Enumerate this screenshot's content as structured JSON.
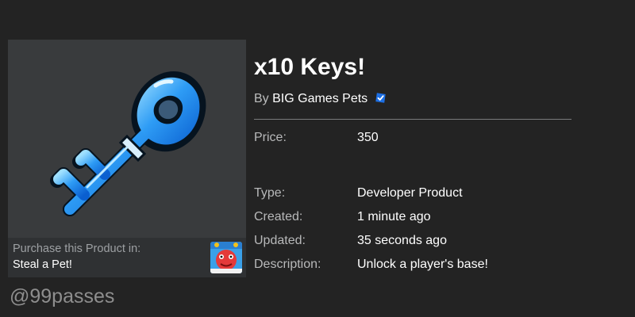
{
  "product": {
    "title": "x10 Keys!",
    "by_prefix": "By",
    "creator": "BIG Games Pets",
    "image_icon": "blue-key-icon"
  },
  "purchase": {
    "label": "Purchase this Product in:",
    "game_name": "Steal a Pet!",
    "game_icon": "game-thumbnail-icon"
  },
  "details": {
    "price_label": "Price:",
    "price_value": "350",
    "type_label": "Type:",
    "type_value": "Developer Product",
    "created_label": "Created:",
    "created_value": "1 minute ago",
    "updated_label": "Updated:",
    "updated_value": "35 seconds ago",
    "description_label": "Description:",
    "description_value": "Unlock a player's base!"
  },
  "watermark": "@99passes",
  "colors": {
    "background": "#232323",
    "card": "#393b3d",
    "verified_badge": "#1d6fe3",
    "key_blue": "#2e8ff0"
  }
}
